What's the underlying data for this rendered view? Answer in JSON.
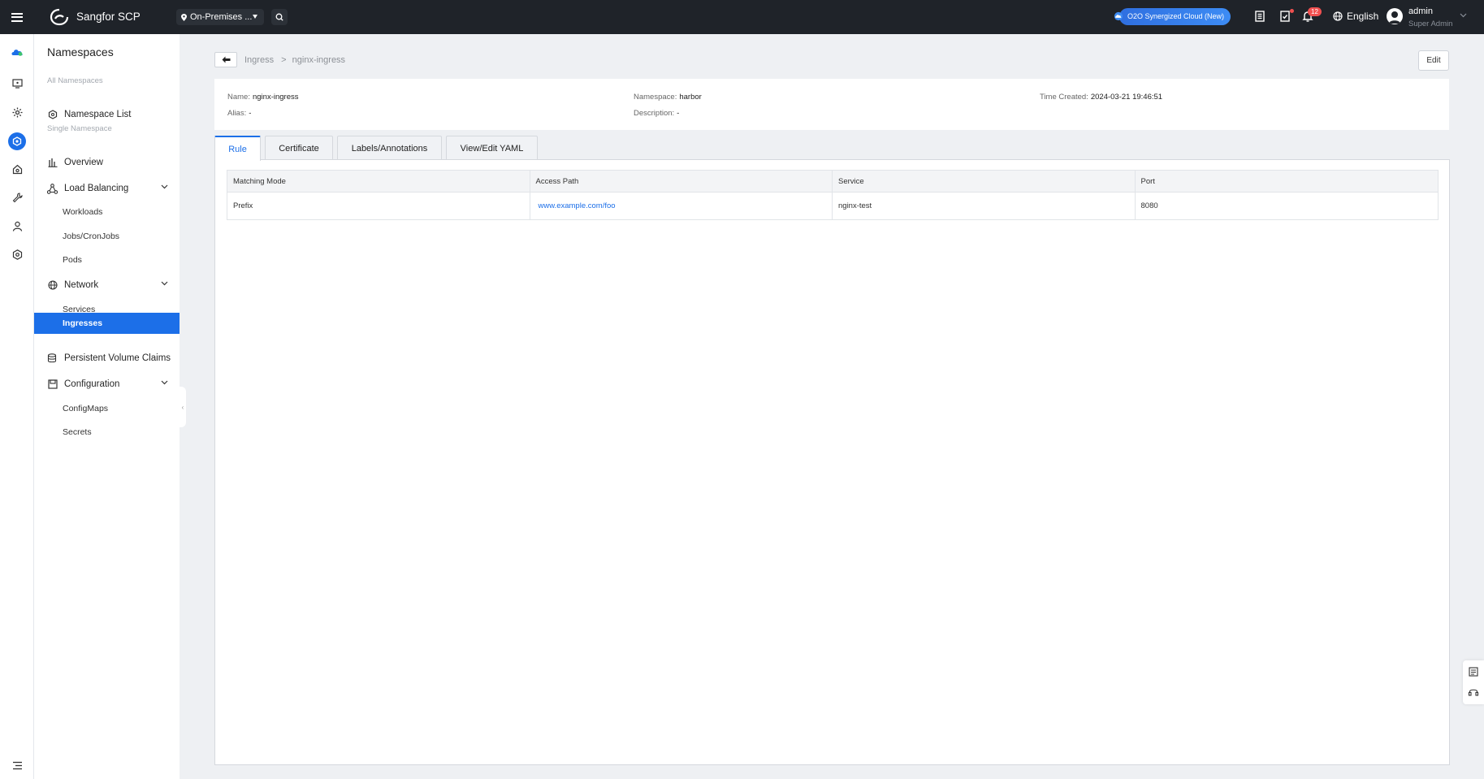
{
  "topbar": {
    "brand": "Sangfor SCP",
    "location": "On-Premises ...",
    "o2o_label": "O2O Synergized Cloud (New)",
    "notification_count": "12",
    "language": "English",
    "user_name": "admin",
    "user_role": "Super Admin"
  },
  "sidenav": {
    "title": "Namespaces",
    "group_all": "All Namespaces",
    "namespace_list": "Namespace List",
    "group_single": "Single Namespace",
    "overview": "Overview",
    "load_balancing": "Load Balancing",
    "workloads": "Workloads",
    "jobs_cronjobs": "Jobs/CronJobs",
    "pods": "Pods",
    "network": "Network",
    "services": "Services",
    "ingresses": "Ingresses",
    "pvc": "Persistent Volume Claims",
    "configuration": "Configuration",
    "configmaps": "ConfigMaps",
    "secrets": "Secrets"
  },
  "breadcrumb": {
    "parent": "Ingress",
    "separator": ">",
    "current": "nginx-ingress"
  },
  "edit_label": "Edit",
  "info": {
    "name_label": "Name:",
    "name_value": "nginx-ingress",
    "alias_label": "Alias:",
    "alias_value": "-",
    "namespace_label": "Namespace:",
    "namespace_value": "harbor",
    "description_label": "Description:",
    "description_value": "-",
    "time_created_label": "Time Created:",
    "time_created_value": "2024-03-21 19:46:51"
  },
  "tabs": [
    "Rule",
    "Certificate",
    "Labels/Annotations",
    "View/Edit YAML"
  ],
  "table": {
    "headers": [
      "Matching Mode",
      "Access Path",
      "Service",
      "Port"
    ],
    "rows": [
      [
        "Prefix",
        "www.example.com/foo",
        "nginx-test",
        "8080"
      ]
    ]
  },
  "colors": {
    "accent": "#1c6fe8",
    "topbar": "#1f2329",
    "badge": "#f05050"
  },
  "icons": [
    "menu-icon",
    "sangfor-logo",
    "location-pin-icon",
    "search-icon",
    "o2o-cloud-icon",
    "document-list-icon",
    "task-icon",
    "bell-icon",
    "globe-icon",
    "user-avatar-icon",
    "chevron-down-icon",
    "cloud-icon",
    "monitor-icon",
    "gear-icon",
    "namespace-icon",
    "workshop-icon",
    "wrench-icon",
    "person-icon",
    "hexagon-icon",
    "collapse-menu-icon"
  ]
}
